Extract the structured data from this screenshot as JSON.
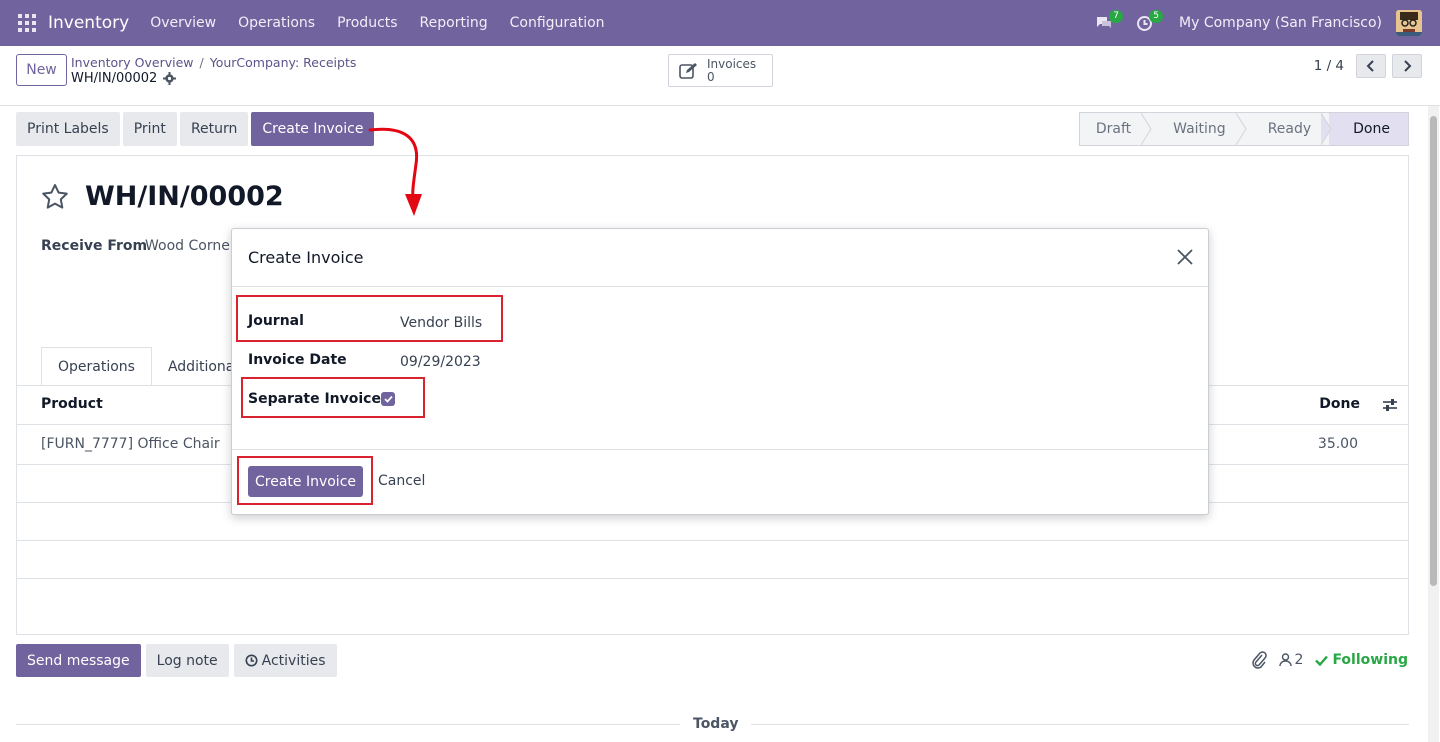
{
  "navbar": {
    "app_name": "Inventory",
    "menu": [
      "Overview",
      "Operations",
      "Products",
      "Reporting",
      "Configuration"
    ],
    "messages_count": "7",
    "activities_count": "5",
    "company": "My Company (San Francisco)"
  },
  "control_panel": {
    "new_label": "New",
    "breadcrumb": [
      "Inventory Overview",
      "YourCompany: Receipts"
    ],
    "current_record": "WH/IN/00002",
    "smart_button": {
      "label": "Invoices",
      "count": "0"
    },
    "pager": "1 / 4"
  },
  "actions": [
    "Print Labels",
    "Print",
    "Return",
    "Create Invoice"
  ],
  "stages": [
    "Draft",
    "Waiting",
    "Ready",
    "Done"
  ],
  "active_stage": "Done",
  "form": {
    "title": "WH/IN/00002",
    "receive_from_label": "Receive From",
    "receive_from_value": "Wood Corner",
    "tabs": [
      "Operations",
      "Additional"
    ],
    "columns": {
      "product": "Product",
      "done": "Done"
    },
    "lines": [
      {
        "product": "[FURN_7777] Office Chair",
        "done": "35.00"
      }
    ]
  },
  "chatter": {
    "send_message": "Send message",
    "log_note": "Log note",
    "activities": "Activities",
    "followers_count": "2",
    "following": "Following",
    "today": "Today"
  },
  "dialog": {
    "title": "Create Invoice",
    "journal_label": "Journal",
    "journal_value": "Vendor Bills",
    "invoice_date_label": "Invoice Date",
    "invoice_date_value": "09/29/2023",
    "separate_label": "Separate Invoice ?",
    "separate_checked": true,
    "create_label": "Create Invoice",
    "cancel_label": "Cancel"
  },
  "colors": {
    "brand": "#71639e",
    "annotation": "#d9232e",
    "success": "#28a745"
  }
}
